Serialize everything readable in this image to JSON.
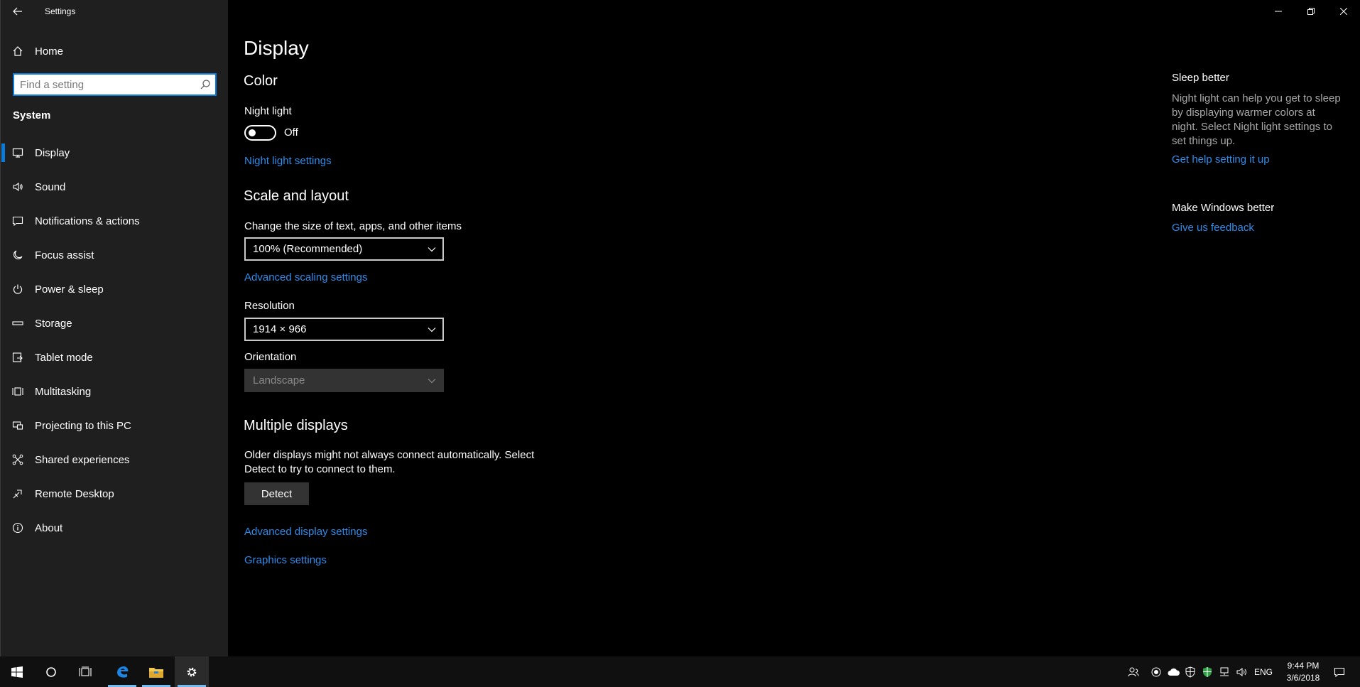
{
  "window": {
    "title": "Settings"
  },
  "sidebar": {
    "home_label": "Home",
    "search_placeholder": "Find a setting",
    "section_label": "System",
    "items": [
      {
        "label": "Display",
        "icon": "display-icon",
        "active": true
      },
      {
        "label": "Sound",
        "icon": "speaker-icon"
      },
      {
        "label": "Notifications & actions",
        "icon": "notification-icon"
      },
      {
        "label": "Focus assist",
        "icon": "moon-icon"
      },
      {
        "label": "Power & sleep",
        "icon": "power-icon"
      },
      {
        "label": "Storage",
        "icon": "storage-icon"
      },
      {
        "label": "Tablet mode",
        "icon": "tablet-icon"
      },
      {
        "label": "Multitasking",
        "icon": "multitasking-icon"
      },
      {
        "label": "Projecting to this PC",
        "icon": "projecting-icon"
      },
      {
        "label": "Shared experiences",
        "icon": "shared-icon"
      },
      {
        "label": "Remote Desktop",
        "icon": "remote-desktop-icon"
      },
      {
        "label": "About",
        "icon": "info-icon"
      }
    ]
  },
  "main": {
    "title": "Display",
    "color": {
      "heading": "Color",
      "night_light_label": "Night light",
      "night_light_state": "Off",
      "night_light_settings_link": "Night light settings"
    },
    "scale": {
      "heading": "Scale and layout",
      "size_label": "Change the size of text, apps, and other items",
      "size_value": "100% (Recommended)",
      "advanced_scaling_link": "Advanced scaling settings",
      "resolution_label": "Resolution",
      "resolution_value": "1914 × 966",
      "orientation_label": "Orientation",
      "orientation_value": "Landscape"
    },
    "multiple": {
      "heading": "Multiple displays",
      "description": "Older displays might not always connect automatically. Select Detect to try to connect to them.",
      "detect_button": "Detect",
      "advanced_display_link": "Advanced display settings",
      "graphics_link": "Graphics settings"
    }
  },
  "side_panel": {
    "sleep_title": "Sleep better",
    "sleep_text": "Night light can help you get to sleep by displaying warmer colors at night. Select Night light settings to set things up.",
    "help_link": "Get help setting it up",
    "feedback_title": "Make Windows better",
    "feedback_link": "Give us feedback"
  },
  "taskbar": {
    "language": "ENG",
    "time": "9:44 PM",
    "date": "3/6/2018"
  },
  "colors": {
    "accent": "#0a7bd8",
    "link": "#2e8cec",
    "sidebar_bg": "#1f1f1f",
    "main_bg": "#000000",
    "taskbar_bg": "#101010"
  }
}
